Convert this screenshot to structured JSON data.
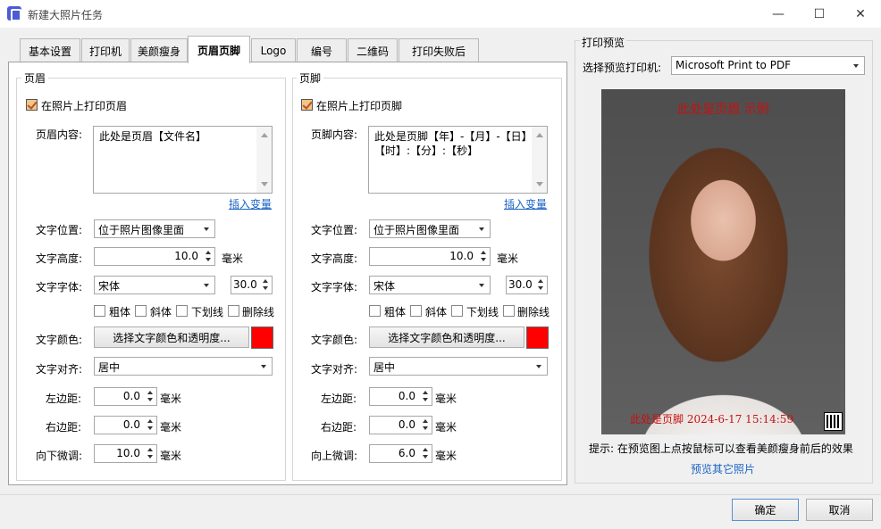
{
  "window": {
    "title": "新建大照片任务"
  },
  "tabs": [
    {
      "label": "基本设置"
    },
    {
      "label": "打印机"
    },
    {
      "label": "美颜瘦身"
    },
    {
      "label": "页眉页脚"
    },
    {
      "label": "Logo"
    },
    {
      "label": "编号"
    },
    {
      "label": "二维码"
    },
    {
      "label": "打印失败后"
    }
  ],
  "header": {
    "group_title": "页眉",
    "enable_label": "在照片上打印页眉",
    "content_label": "页眉内容:",
    "content_value": "此处是页眉【文件名】",
    "insert_var": "插入变量",
    "position_label": "文字位置:",
    "position_value": "位于照片图像里面",
    "height_label": "文字高度:",
    "height_value": "10.0",
    "height_unit": "毫米",
    "font_label": "文字字体:",
    "font_value": "宋体",
    "font_size": "30.0",
    "bold": "粗体",
    "italic": "斜体",
    "underline": "下划线",
    "strike": "删除线",
    "color_label": "文字颜色:",
    "color_button": "选择文字颜色和透明度...",
    "color": "#ff0000",
    "align_label": "文字对齐:",
    "align_value": "居中",
    "left_label": "左边距:",
    "left_value": "0.0",
    "right_label": "右边距:",
    "right_value": "0.0",
    "offset_label": "向下微调:",
    "offset_value": "10.0",
    "unit": "毫米"
  },
  "footer": {
    "group_title": "页脚",
    "enable_label": "在照片上打印页脚",
    "content_label": "页脚内容:",
    "content_value": "此处是页脚【年】-【月】-【日】【时】:【分】:【秒】",
    "insert_var": "插入变量",
    "position_label": "文字位置:",
    "position_value": "位于照片图像里面",
    "height_label": "文字高度:",
    "height_value": "10.0",
    "height_unit": "毫米",
    "font_label": "文字字体:",
    "font_value": "宋体",
    "font_size": "30.0",
    "bold": "粗体",
    "italic": "斜体",
    "underline": "下划线",
    "strike": "删除线",
    "color_label": "文字颜色:",
    "color_button": "选择文字颜色和透明度...",
    "color": "#ff0000",
    "align_label": "文字对齐:",
    "align_value": "居中",
    "left_label": "左边距:",
    "left_value": "0.0",
    "right_label": "右边距:",
    "right_value": "0.0",
    "offset_label": "向上微调:",
    "offset_value": "6.0",
    "unit": "毫米"
  },
  "preview": {
    "group_title": "打印预览",
    "printer_label": "选择预览打印机:",
    "printer_value": "Microsoft Print to PDF",
    "photo_header_text": "此处是页眉 示例",
    "photo_footer_text": "此处是页脚 2024-6-17 15:14:59",
    "hint": "提示: 在预览图上点按鼠标可以查看美颜瘦身前后的效果",
    "other_link": "预览其它照片"
  },
  "buttons": {
    "ok": "确定",
    "cancel": "取消"
  }
}
